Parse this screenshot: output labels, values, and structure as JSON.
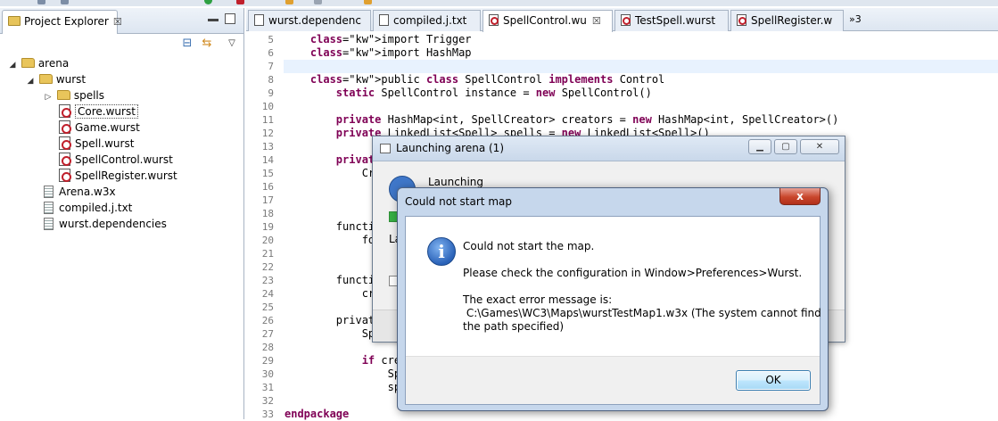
{
  "explorer": {
    "tab_title": "Project Explorer",
    "tab_close": "☒",
    "tree": [
      {
        "label": "arena",
        "kind": "folder",
        "twisty": "◢"
      },
      {
        "label": "wurst",
        "kind": "folder",
        "twisty": "◢"
      },
      {
        "label": "spells",
        "kind": "folder",
        "twisty": "▷"
      },
      {
        "label": "Core.wurst",
        "kind": "wurst"
      },
      {
        "label": "Game.wurst",
        "kind": "wurst"
      },
      {
        "label": "Spell.wurst",
        "kind": "wurst"
      },
      {
        "label": "SpellControl.wurst",
        "kind": "wurst"
      },
      {
        "label": "SpellRegister.wurst",
        "kind": "wurst"
      },
      {
        "label": "Arena.w3x",
        "kind": "plain"
      },
      {
        "label": "compiled.j.txt",
        "kind": "plain"
      },
      {
        "label": "wurst.dependencies",
        "kind": "plain"
      }
    ]
  },
  "editor": {
    "tabs": [
      {
        "label": "wurst.dependenc",
        "icon": "plain-file-icon"
      },
      {
        "label": "compiled.j.txt",
        "icon": "plain-file-icon"
      },
      {
        "label": "SpellControl.wu",
        "icon": "wurst-file-icon",
        "active": true,
        "close": "☒"
      },
      {
        "label": "TestSpell.wurst",
        "icon": "wurst-file-icon"
      },
      {
        "label": "SpellRegister.w",
        "icon": "wurst-file-icon"
      }
    ],
    "more_tabs": "»3",
    "lines": [
      {
        "n": "5",
        "code": "    import Trigger"
      },
      {
        "n": "6",
        "code": "    import HashMap"
      },
      {
        "n": "7",
        "code": ""
      },
      {
        "n": "8",
        "code": "    public class SpellControl implements Control"
      },
      {
        "n": "9",
        "code": "        static SpellControl instance = new SpellControl()"
      },
      {
        "n": "10",
        "code": ""
      },
      {
        "n": "11",
        "code": "        private HashMap<int, SpellCreator> creators = new HashMap<int, SpellCreator>()"
      },
      {
        "n": "12",
        "code": "        private LinkedList<Spell> spells = new LinkedList<Spell>()"
      },
      {
        "n": "13",
        "code": ""
      },
      {
        "n": "14",
        "code": "        private"
      },
      {
        "n": "15",
        "code": "            Cr"
      },
      {
        "n": "16",
        "code": ""
      },
      {
        "n": "17",
        "code": ""
      },
      {
        "n": "18",
        "code": ""
      },
      {
        "n": "19",
        "code": "        functi"
      },
      {
        "n": "20",
        "code": "            fo"
      },
      {
        "n": "21",
        "code": ""
      },
      {
        "n": "22",
        "code": ""
      },
      {
        "n": "23",
        "code": "        functi"
      },
      {
        "n": "24",
        "code": "            cr"
      },
      {
        "n": "25",
        "code": ""
      },
      {
        "n": "26",
        "code": "        privat"
      },
      {
        "n": "27",
        "code": "            Sp"
      },
      {
        "n": "28",
        "code": ""
      },
      {
        "n": "29",
        "code": "            if cre"
      },
      {
        "n": "30",
        "code": "                Sp"
      },
      {
        "n": "31",
        "code": "                sp"
      },
      {
        "n": "32",
        "code": ""
      },
      {
        "n": "33",
        "code": "endpackage"
      }
    ]
  },
  "launch_dialog": {
    "title": "Launching arena (1)",
    "heading": "Launching",
    "status_partial": "La",
    "progress": 0.03
  },
  "error_dialog": {
    "title": "Could not start map",
    "close_label": "x",
    "info_icon": "i",
    "line1": "Could not start the map.",
    "line2": "Please check the configuration in Window>Preferences>Wurst.",
    "line3": "The exact error message is:",
    "line4": " C:\\Games\\WC3\\Maps\\wurstTestMap1.w3x (The system cannot find",
    "line5": "the path specified)",
    "ok_label": "OK"
  }
}
